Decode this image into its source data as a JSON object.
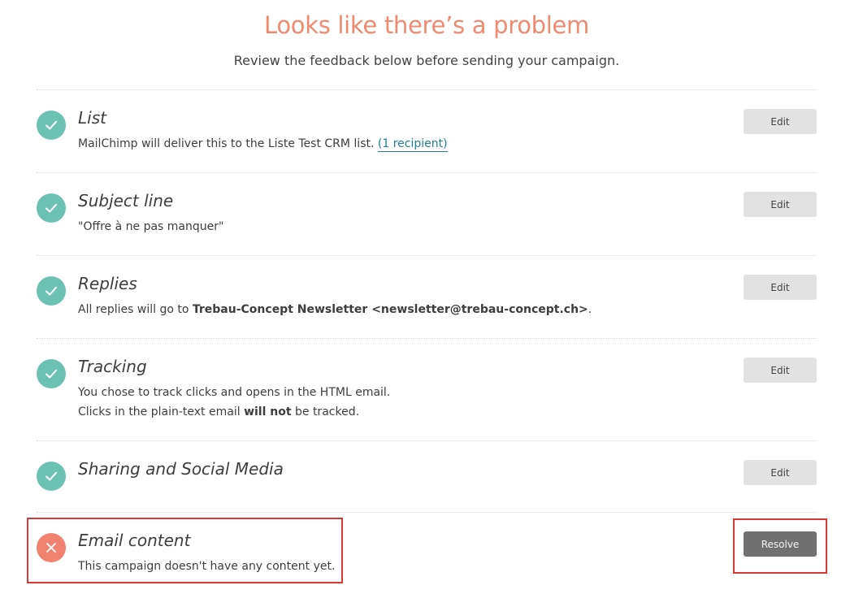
{
  "header": {
    "title": "Looks like there’s a problem",
    "subtitle": "Review the feedback below before sending your campaign."
  },
  "colors": {
    "accent": "#ef8a6f",
    "ok": "#6cc1b3",
    "error": "#f0826f",
    "link": "#1e7e8f",
    "highlight": "#d63a36"
  },
  "items": [
    {
      "title": "List",
      "status": "ok",
      "status_icon": "checkmark-icon",
      "desc_prefix": "MailChimp will deliver this to the Liste Test CRM list. ",
      "desc_link": "(1 recipient)",
      "button": "Edit"
    },
    {
      "title": "Subject line",
      "status": "ok",
      "status_icon": "checkmark-icon",
      "desc": "\"Offre à ne pas manquer\"",
      "button": "Edit"
    },
    {
      "title": "Replies",
      "status": "ok",
      "status_icon": "checkmark-icon",
      "desc_prefix": "All replies will go to ",
      "desc_bold": "Trebau-Concept Newsletter <newsletter@trebau-concept.ch>",
      "desc_suffix": ".",
      "button": "Edit"
    },
    {
      "title": "Tracking",
      "status": "ok",
      "status_icon": "checkmark-icon",
      "desc_line1": "You chose to track clicks and opens in the HTML email.",
      "desc_line2_prefix": "Clicks in the plain-text email ",
      "desc_line2_bold": "will not",
      "desc_line2_suffix": " be tracked.",
      "button": "Edit"
    },
    {
      "title": "Sharing and Social Media",
      "status": "ok",
      "status_icon": "checkmark-icon",
      "button": "Edit"
    },
    {
      "title": "Email content",
      "status": "error",
      "status_icon": "close-icon",
      "desc": "This campaign doesn't have any content yet.",
      "button": "Resolve"
    }
  ]
}
